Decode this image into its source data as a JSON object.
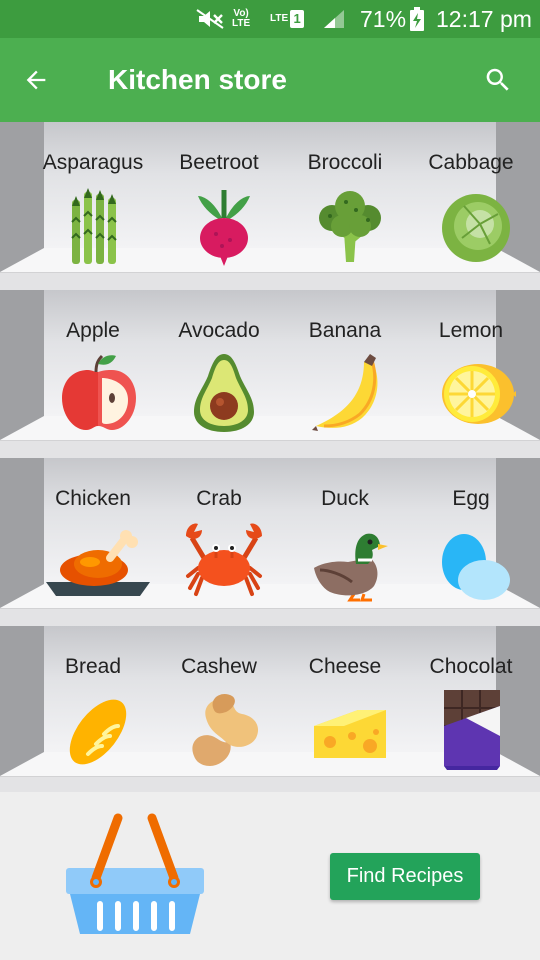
{
  "status_bar": {
    "volte_line1": "Vo)",
    "volte_line2": "LTE",
    "lte_label": "LTE",
    "sim_slot": "1",
    "battery_percent": "71%",
    "time": "12:17 pm",
    "icons": [
      "mute-icon",
      "volte-icon",
      "signal-icon",
      "battery-charging-icon"
    ]
  },
  "app_bar": {
    "title": "Kitchen store",
    "back_icon": "arrow-left-icon",
    "search_icon": "search-icon",
    "color": "#4caf50"
  },
  "shelves": [
    {
      "items": [
        {
          "name": "Asparagus",
          "icon": "asparagus-icon"
        },
        {
          "name": "Beetroot",
          "icon": "beetroot-icon"
        },
        {
          "name": "Broccoli",
          "icon": "broccoli-icon"
        },
        {
          "name": "Cabbage",
          "icon": "cabbage-icon"
        }
      ]
    },
    {
      "items": [
        {
          "name": "Apple",
          "icon": "apple-icon"
        },
        {
          "name": "Avocado",
          "icon": "avocado-icon"
        },
        {
          "name": "Banana",
          "icon": "banana-icon"
        },
        {
          "name": "Lemon",
          "icon": "lemon-icon"
        }
      ]
    },
    {
      "items": [
        {
          "name": "Chicken",
          "icon": "chicken-icon"
        },
        {
          "name": "Crab",
          "icon": "crab-icon"
        },
        {
          "name": "Duck",
          "icon": "duck-icon"
        },
        {
          "name": "Egg",
          "icon": "egg-icon"
        }
      ]
    },
    {
      "items": [
        {
          "name": "Bread",
          "icon": "bread-icon"
        },
        {
          "name": "Cashew",
          "icon": "cashew-icon"
        },
        {
          "name": "Cheese",
          "icon": "cheese-icon"
        },
        {
          "name": "Chocolat",
          "icon": "chocolate-icon"
        }
      ]
    }
  ],
  "footer": {
    "basket_icon": "basket-icon",
    "find_button": "Find Recipes",
    "button_color": "#23a35a"
  }
}
